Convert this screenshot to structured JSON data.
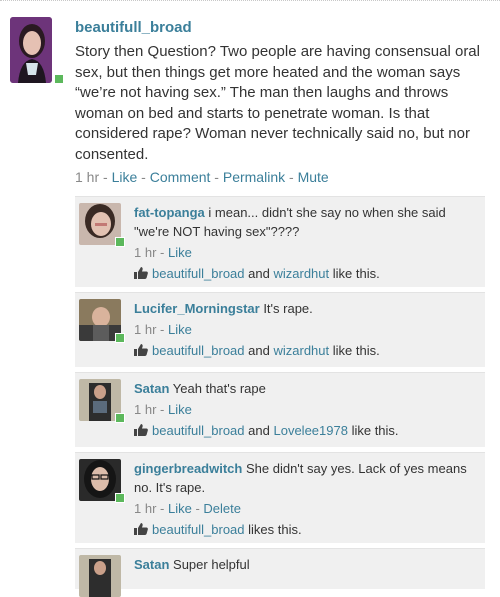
{
  "post": {
    "username": "beautifull_broad",
    "text": "Story then Question? Two people are having consensual oral sex, but then things get more heated and the woman says “we’re not having sex.” The man then laughs and throws woman on bed and starts to penetrate woman. Is that considered rape? Woman never technically said no, but nor consented.",
    "meta": {
      "time": "1 hr",
      "sep": " - ",
      "actions": [
        "Like",
        "Comment",
        "Permalink",
        "Mute"
      ]
    }
  },
  "comments": [
    {
      "username": "fat-topanga",
      "text": "i mean... didn't she say no when she said \"we're NOT having sex\"????",
      "time": "1 hr",
      "actions": [
        "Like"
      ],
      "likes": {
        "users": [
          "beautifull_broad",
          "wizardhut"
        ],
        "joiner": "and",
        "suffix": "like this."
      }
    },
    {
      "username": "Lucifer_Morningstar",
      "text": "It's rape.",
      "time": "1 hr",
      "actions": [
        "Like"
      ],
      "likes": {
        "users": [
          "beautifull_broad",
          "wizardhut"
        ],
        "joiner": "and",
        "suffix": "like this."
      }
    },
    {
      "username": "Satan",
      "text": "Yeah that's rape",
      "time": "1 hr",
      "actions": [
        "Like"
      ],
      "likes": {
        "users": [
          "beautifull_broad",
          "Lovelee1978"
        ],
        "joiner": "and",
        "suffix": "like this."
      }
    },
    {
      "username": "gingerbreadwitch",
      "text": "She didn't say yes. Lack of yes means no. It's rape.",
      "time": "1 hr",
      "actions": [
        "Like",
        "Delete"
      ],
      "likes": {
        "users": [
          "beautifull_broad"
        ],
        "joiner": "",
        "suffix": "likes this."
      }
    },
    {
      "username": "Satan",
      "text": "Super helpful"
    }
  ],
  "colors": {
    "link": "#3b7f9a",
    "online": "#5cb85c",
    "comment_bg": "#f0f0f0"
  },
  "icons": {
    "like": "thumbs-up-icon",
    "online": "online-status-icon"
  }
}
